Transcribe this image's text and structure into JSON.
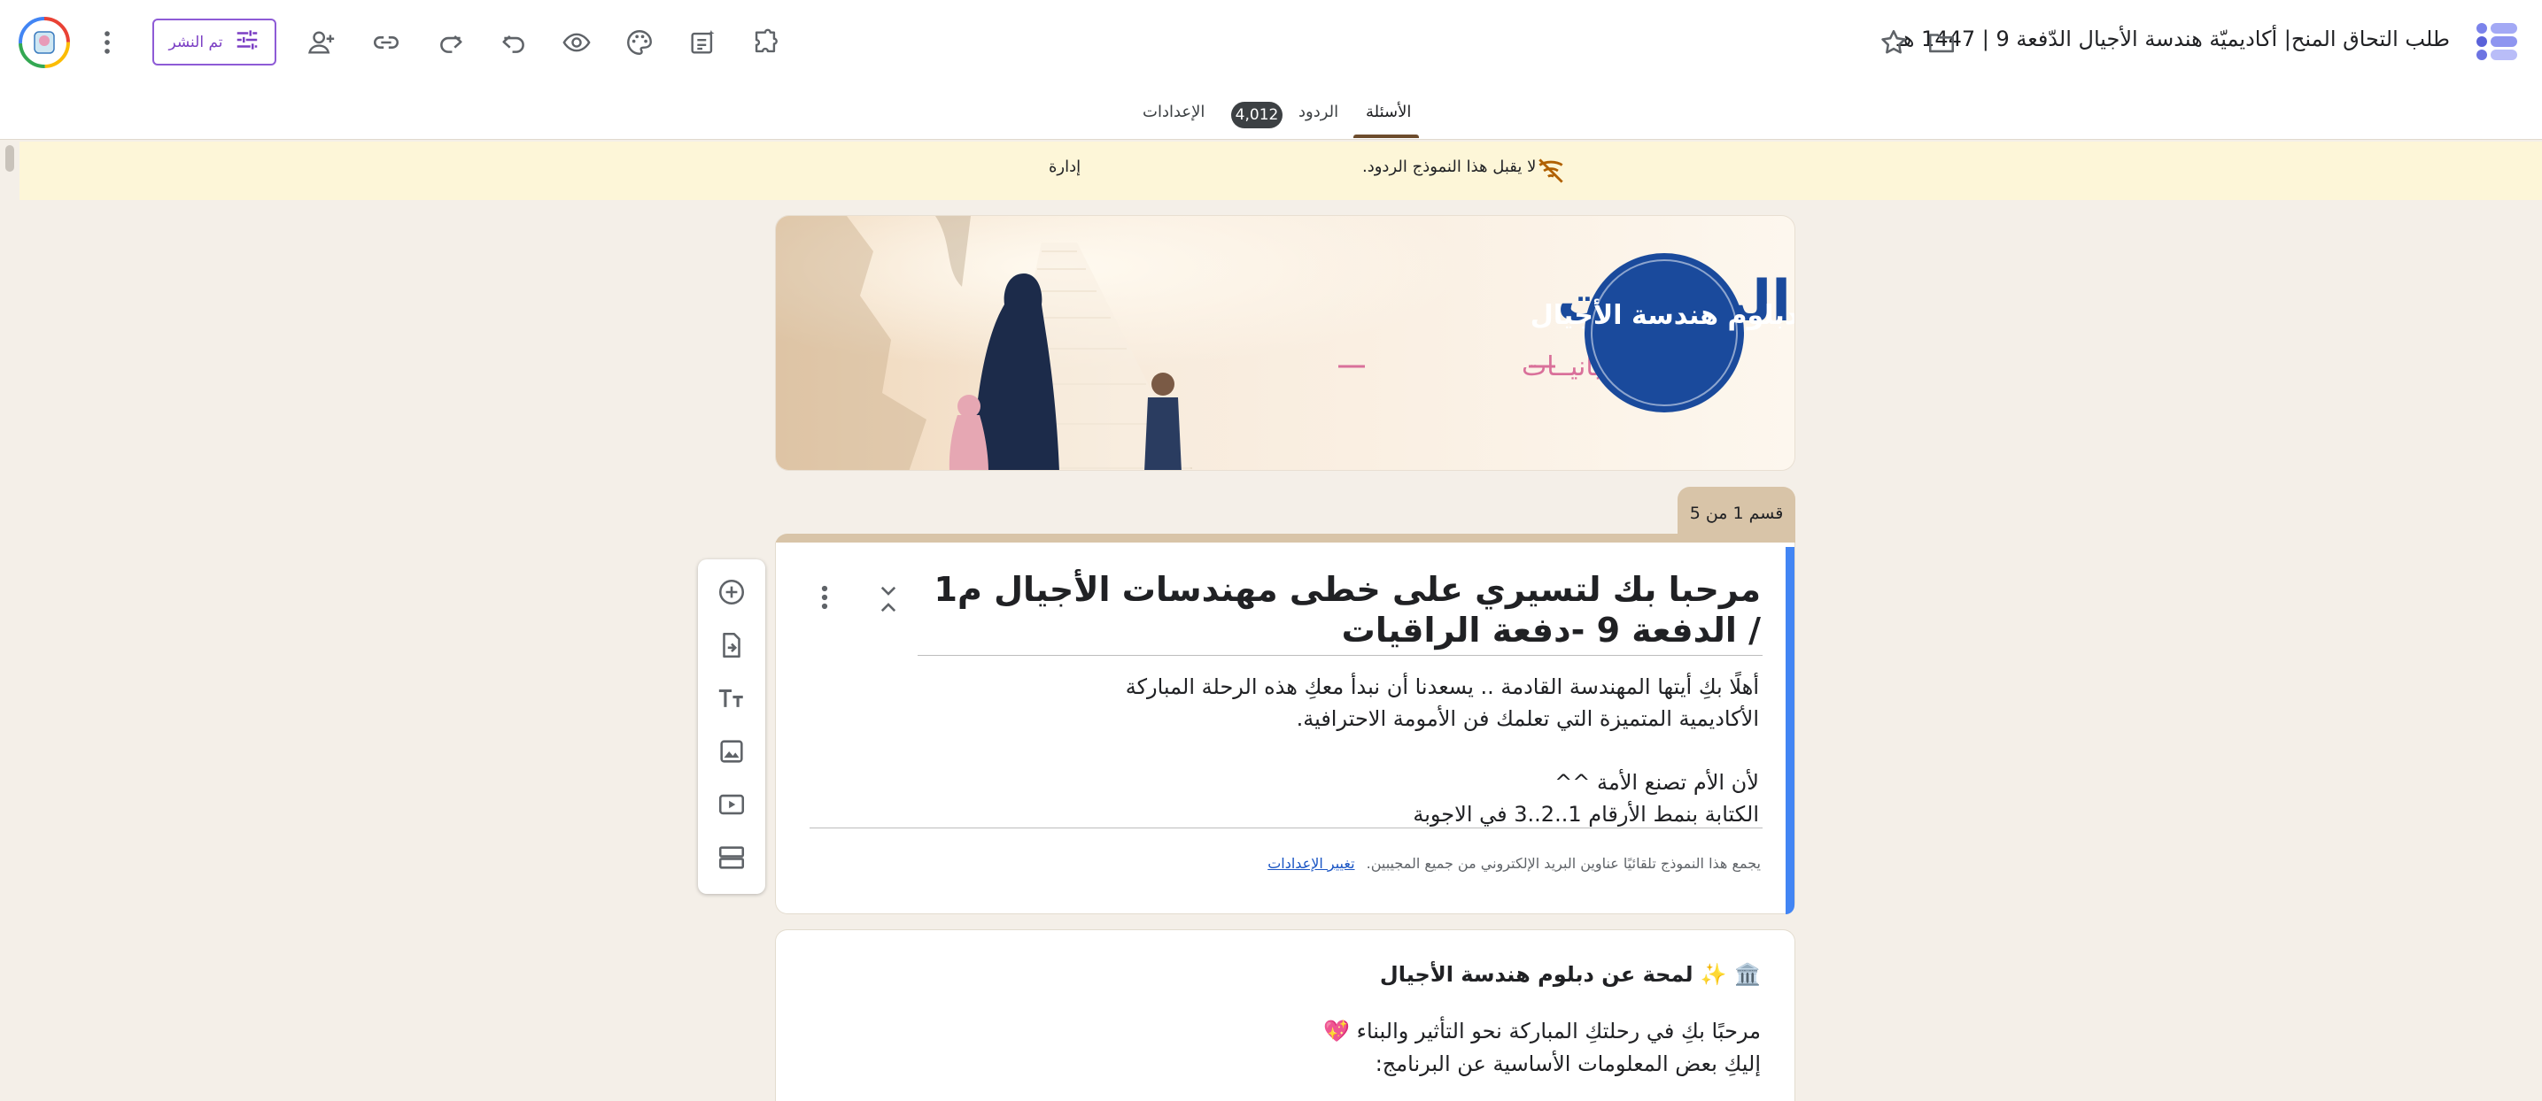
{
  "header": {
    "doc_title": "طلب التحاق المنح| أكاديميّة هندسة الأجيال الدّفعة 9 | 1447 هـ",
    "publish_label": "تم النشر"
  },
  "tabs": {
    "questions": "الأسئلة",
    "responses": "الردود",
    "responses_count": "4,012",
    "settings": "الإعدادات"
  },
  "notice": {
    "text": "لا يقبل هذا النموذج الردود.",
    "manage": "إدارة"
  },
  "hero": {
    "logo_text": "دبلوم هندسة الأجيال",
    "headline": "دفعة الراقيات",
    "tagline": "للأمّــة بانيــات"
  },
  "section": {
    "tab_label": "قسم 1 من 5",
    "title": "مرحبا بك لتسيري على خطى مهندسات الأجيال م1 / الدفعة 9 -دفعة الراقيات",
    "description": "أهلًا بكِ أيتها المهندسة القادمة .. يسعدنا أن نبدأ معكِ هذه الرحلة المباركة\nالأكاديمية المتميزة التي تعلمك فن الأمومة الاحترافية.\n\nلأن الأم تصنع الأمة ^^\nالكتابة بنمط الأرقام 1..2..3 في الاجوبة",
    "email_note": "يجمع هذا النموذج تلقائيًا عناوين البريد الإلكتروني من جميع المجيبين.",
    "email_link": "تغيير الإعدادات"
  },
  "card2": {
    "title": "🏛️ ✨ لمحة عن دبلوم هندسة الأجيال",
    "body": "مرحبًا بكِ في رحلتكِ المباركة نحو التأثير والبناء 💖\nإليكِ بعض المعلومات الأساسية عن البرنامج:"
  },
  "colors": {
    "accent_blue": "#4285f4",
    "section_tan": "#d8c4a8",
    "notice_bg": "#fdf6d8",
    "publish_purple": "#7b3fc4",
    "hero_navy": "#1a4a9c",
    "hero_pink": "#d9709a"
  },
  "icons": {
    "top_left": [
      "more-vert-icon",
      "tune-icon",
      "person-add-icon",
      "link-icon",
      "redo-icon",
      "undo-icon",
      "preview-icon",
      "palette-icon",
      "ai-form-icon",
      "addon-puzzle-icon"
    ],
    "top_right": [
      "star-icon",
      "folder-icon",
      "forms-logo-icon"
    ],
    "toolbar": [
      "add-question-icon",
      "import-questions-icon",
      "add-title-icon",
      "add-image-icon",
      "add-video-icon",
      "add-section-icon"
    ]
  }
}
